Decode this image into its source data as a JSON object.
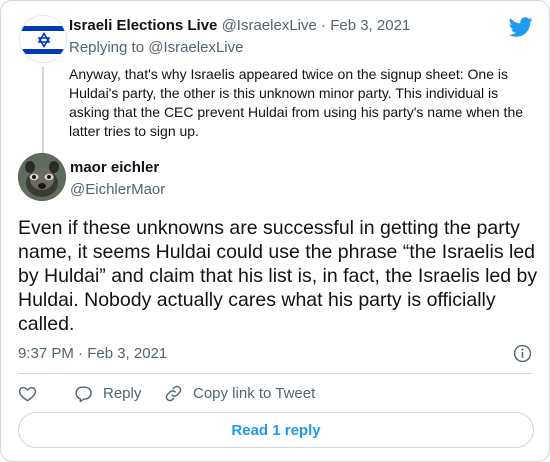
{
  "parent_tweet": {
    "display_name": "Israeli Elections Live",
    "handle": "@IsraelexLive",
    "separator": "·",
    "date": "Feb 3, 2021",
    "replying_to_label": "Replying to",
    "replying_to_handle": "@IsraelexLive",
    "text": "Anyway, that's why Israelis appeared twice on the signup sheet: One is Huldai's party, the other is this unknown minor party. This individual is asking that the CEC prevent Huldai from using his party's name when the latter tries to sign up.",
    "avatar_icon": "israel-flag"
  },
  "main_tweet": {
    "display_name": "maor eichler",
    "handle": "@EichlerMaor",
    "avatar_icon": "dog-photo",
    "text": "Even if these unknowns are successful in getting the party name, it seems Huldai could use the phrase “the Israelis led by Huldai” and claim that his list is, in fact, the Israelis led by Huldai. Nobody actually cares what his party is officially called.",
    "timestamp": "9:37 PM · Feb 3, 2021"
  },
  "actions": {
    "like_icon": "heart-icon",
    "reply_label": "Reply",
    "copy_link_label": "Copy link to Tweet"
  },
  "read_replies_label": "Read 1 reply",
  "colors": {
    "accent": "#1d9bf0",
    "secondary_text": "#536471",
    "border": "#cfd9de",
    "israel_blue": "#0038b8"
  }
}
